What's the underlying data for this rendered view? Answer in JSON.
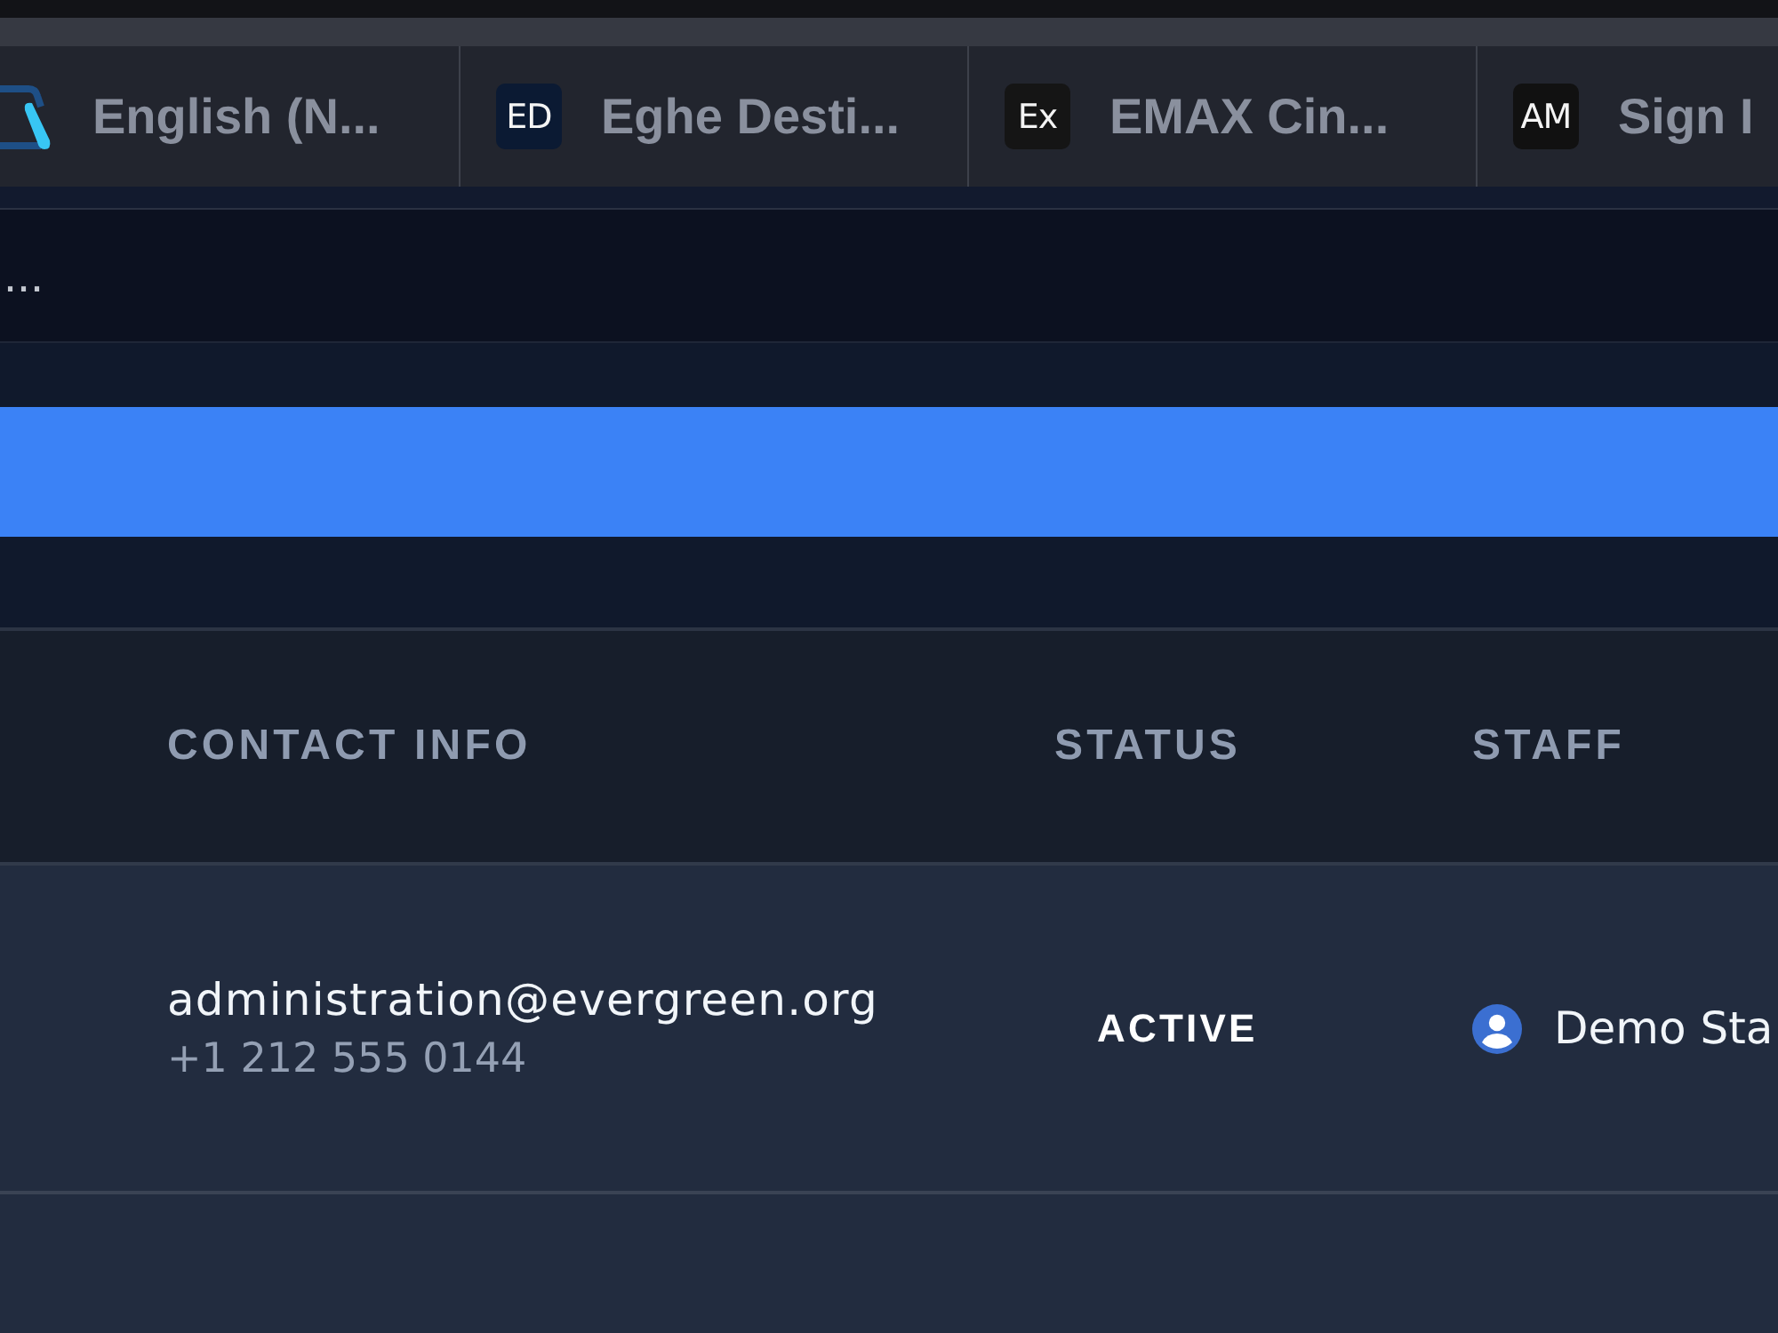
{
  "browser": {
    "tabs": [
      {
        "kind": "logo",
        "label": "English (N..."
      },
      {
        "kind": "badge",
        "badge": "ED",
        "color": "#0b1a33",
        "label": "Eghe Desti..."
      },
      {
        "kind": "badge",
        "badge": "Ex",
        "color": "#151515",
        "label": "EMAX Cin..."
      },
      {
        "kind": "badge",
        "badge": "AM",
        "color": "#111111",
        "label": "Sign I"
      }
    ]
  },
  "search": {
    "placeholder": "..."
  },
  "table": {
    "columns": [
      "CONTACT INFO",
      "STATUS",
      "STAFF"
    ],
    "rows": [
      {
        "email": "administration@evergreen.org",
        "phone": "+1 212 555 0144",
        "status": "ACTIVE",
        "staff": "Demo Sta"
      }
    ]
  }
}
